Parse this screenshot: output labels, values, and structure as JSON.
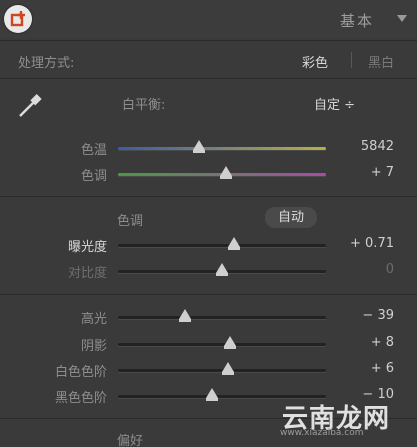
{
  "header": {
    "title": "基本"
  },
  "treatment": {
    "label": "处理方式:",
    "color": "彩色",
    "bw": "黑白"
  },
  "white_balance": {
    "label": "白平衡:",
    "value": "自定 ÷"
  },
  "wb_sliders": [
    {
      "label": "色温",
      "value": "5842",
      "pos": 0.39
    },
    {
      "label": "色调",
      "value": "+ 7",
      "pos": 0.52
    }
  ],
  "tone": {
    "label": "色调",
    "auto": "自动"
  },
  "tone_sliders": [
    {
      "label": "曝光度",
      "value": "+ 0.71",
      "pos": 0.56
    },
    {
      "label": "对比度",
      "value": "0",
      "pos": 0.5
    }
  ],
  "presence_sliders": [
    {
      "label": "高光",
      "value": "− 39",
      "pos": 0.32
    },
    {
      "label": "阴影",
      "value": "+ 8",
      "pos": 0.54
    },
    {
      "label": "白色色阶",
      "value": "+ 6",
      "pos": 0.53
    },
    {
      "label": "黑色色阶",
      "value": "− 10",
      "pos": 0.45
    }
  ],
  "footer": {
    "label": "偏好"
  },
  "watermark": {
    "text": "云南龙网",
    "url": "www.xiazaiba.com"
  },
  "colors": {
    "temp_start": "#3c5aa8",
    "temp_end": "#b8b042",
    "tint_start": "#4a9a42",
    "tint_end": "#a84aa8"
  }
}
